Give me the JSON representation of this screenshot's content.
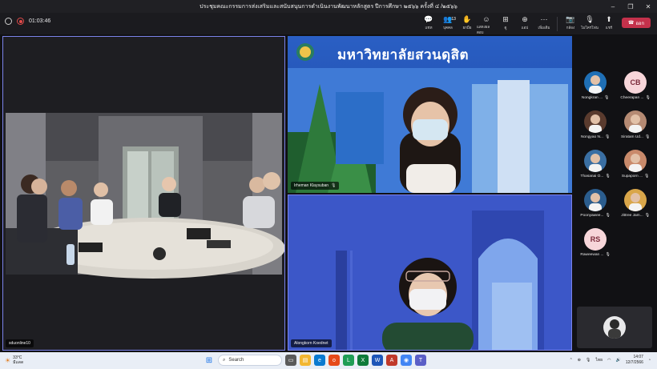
{
  "window": {
    "title": "ประชุมคณะกรรมการส่งเสริมและสนับสนุนการดำเนินงานพัฒนาหลักสูตร ปีการศึกษา ๒๕๖๖ ครั้งที่ ๔ /๒๕๖๖",
    "controls": [
      "–",
      "❐",
      "✕"
    ]
  },
  "toolbar": {
    "timer": "01:03:46",
    "buttons": [
      {
        "icon": "chat-icon",
        "glyph": "💬",
        "label": "แชท"
      },
      {
        "icon": "people-icon",
        "glyph": "👥",
        "label": "บุคคล",
        "badge": "13"
      },
      {
        "icon": "raise-hand-icon",
        "glyph": "✋",
        "label": "ยกมือ"
      },
      {
        "icon": "react-icon",
        "glyph": "☺",
        "label": "แสดงผลตอบ"
      },
      {
        "icon": "view-icon",
        "glyph": "⊞",
        "label": "ดู"
      },
      {
        "icon": "apps-icon",
        "glyph": "⊕",
        "label": "แอป"
      },
      {
        "icon": "more-icon",
        "glyph": "⋯",
        "label": "เพิ่มเติม"
      },
      {
        "icon": "camera-icon",
        "glyph": "📷",
        "label": "กล้อง"
      },
      {
        "icon": "mic-icon",
        "glyph": "🎙",
        "label": "ไมโครโฟน"
      },
      {
        "icon": "share-icon",
        "glyph": "⬆",
        "label": "แชร์"
      }
    ],
    "leave_label": "ออก"
  },
  "videos": [
    {
      "name": "sduonline10"
    },
    {
      "name": "Irheman Klaysuban"
    },
    {
      "name": "Alongkorn Koednet"
    }
  ],
  "banner_text": "มหาวิทยาลัยสวนดุสิต",
  "participants": [
    {
      "name": "Nongkran ...",
      "initials": "",
      "color": "#1f6fb5"
    },
    {
      "name": "Cheerapan ...",
      "initials": "CB",
      "color": "#f7d6da"
    },
    {
      "name": "Nongyao N...",
      "initials": "",
      "color": "#5a3b2e"
    },
    {
      "name": "Siratam Ud...",
      "initials": "",
      "color": "#b58a73"
    },
    {
      "name": "Thasanai O...",
      "initials": "",
      "color": "#3a6fa3"
    },
    {
      "name": "Supaporn ...",
      "initials": "",
      "color": "#c98a6b"
    },
    {
      "name": "Poonyawee...",
      "initials": "",
      "color": "#2b5d8e"
    },
    {
      "name": "Jittree Jam...",
      "initials": "",
      "color": "#d9a64a"
    },
    {
      "name": "Raweewan ...",
      "initials": "RS",
      "color": "#f7d6da"
    }
  ],
  "taskbar": {
    "weather_temp": "33°C",
    "weather_desc": "มีแดด",
    "search_placeholder": "Search",
    "lang": "ไทย",
    "time": "14:07",
    "date": "12/7/2566"
  },
  "colors": {
    "accent": "#7b83eb",
    "leave": "#c4314b",
    "banner_blue": "#2a5fc4",
    "wall_blue": "#3c57c8"
  }
}
